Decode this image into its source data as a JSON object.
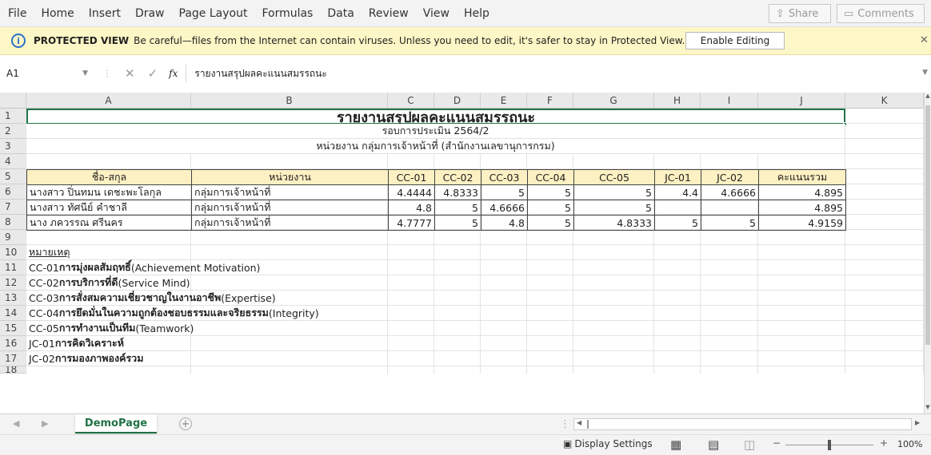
{
  "menu": [
    "File",
    "Home",
    "Insert",
    "Draw",
    "Page Layout",
    "Formulas",
    "Data",
    "Review",
    "View",
    "Help"
  ],
  "share_label": "Share",
  "comments_label": "Comments",
  "protected": {
    "title": "PROTECTED VIEW",
    "message": "Be careful—files from the Internet can contain viruses. Unless you need to edit, it's safer to stay in Protected View.",
    "button": "Enable Editing"
  },
  "formula_bar": {
    "cell_ref": "A1",
    "fx": "fx",
    "content": "รายงานสรุปผลคะแนนสมรรถนะ"
  },
  "columns": [
    "A",
    "B",
    "C",
    "D",
    "E",
    "F",
    "G",
    "H",
    "I",
    "J",
    "K"
  ],
  "rows": [
    "1",
    "2",
    "3",
    "4",
    "5",
    "6",
    "7",
    "8",
    "9",
    "10",
    "11",
    "12",
    "13",
    "14",
    "15",
    "16",
    "17",
    "18"
  ],
  "sheet": {
    "title": "รายงานสรุปผลคะแนนสมรรถนะ",
    "round": "รอบการประเมิน 2564/2",
    "unit": "หน่วยงาน กลุ่มการเจ้าหน้าที่ (สำนักงานเลขานุการกรม)",
    "headers": [
      "ชื่อ-สกุล",
      "หน่วยงาน",
      "CC-01",
      "CC-02",
      "CC-03",
      "CC-04",
      "CC-05",
      "JC-01",
      "JC-02",
      "คะแนนรวม"
    ],
    "data_rows": [
      [
        "นางสาว ปิ่นทมน เดชะพะโลกุล",
        "กลุ่มการเจ้าหน้าที่",
        "4.4444",
        "4.8333",
        "5",
        "5",
        "5",
        "4.4",
        "4.6666",
        "4.895"
      ],
      [
        "นางสาว ทัศนีย์ คำชาลี",
        "กลุ่มการเจ้าหน้าที่",
        "4.8",
        "5",
        "4.6666",
        "5",
        "5",
        "",
        "",
        "4.895"
      ],
      [
        "นาง ภควรรณ ศรีนคร",
        "กลุ่มการเจ้าหน้าที่",
        "4.7777",
        "5",
        "4.8",
        "5",
        "4.8333",
        "5",
        "5",
        "4.9159"
      ]
    ],
    "notes_title": "หมายเหตุ",
    "notes": [
      [
        "CC-01 ",
        "การมุ่งผลสัมฤทธิ์",
        " (Achievement Motivation)"
      ],
      [
        "CC-02 ",
        "การบริการที่ดี",
        " (Service Mind)"
      ],
      [
        "CC-03 ",
        "การสั่งสมความเชี่ยวชาญในงานอาชีพ",
        " (Expertise)"
      ],
      [
        "CC-04 ",
        "การยึดมั่นในความถูกต้องชอบธรรมและจริยธรรม",
        " (Integrity)"
      ],
      [
        "CC-05 ",
        "การทำงานเป็นทีม",
        " (Teamwork)"
      ],
      [
        "JC-01 ",
        "การคิดวิเคราะห์",
        ""
      ],
      [
        "JC-02 ",
        "การมองภาพองค์รวม",
        ""
      ]
    ]
  },
  "sheet_tab": "DemoPage",
  "status": {
    "display_settings": "Display Settings",
    "zoom": "100%"
  }
}
